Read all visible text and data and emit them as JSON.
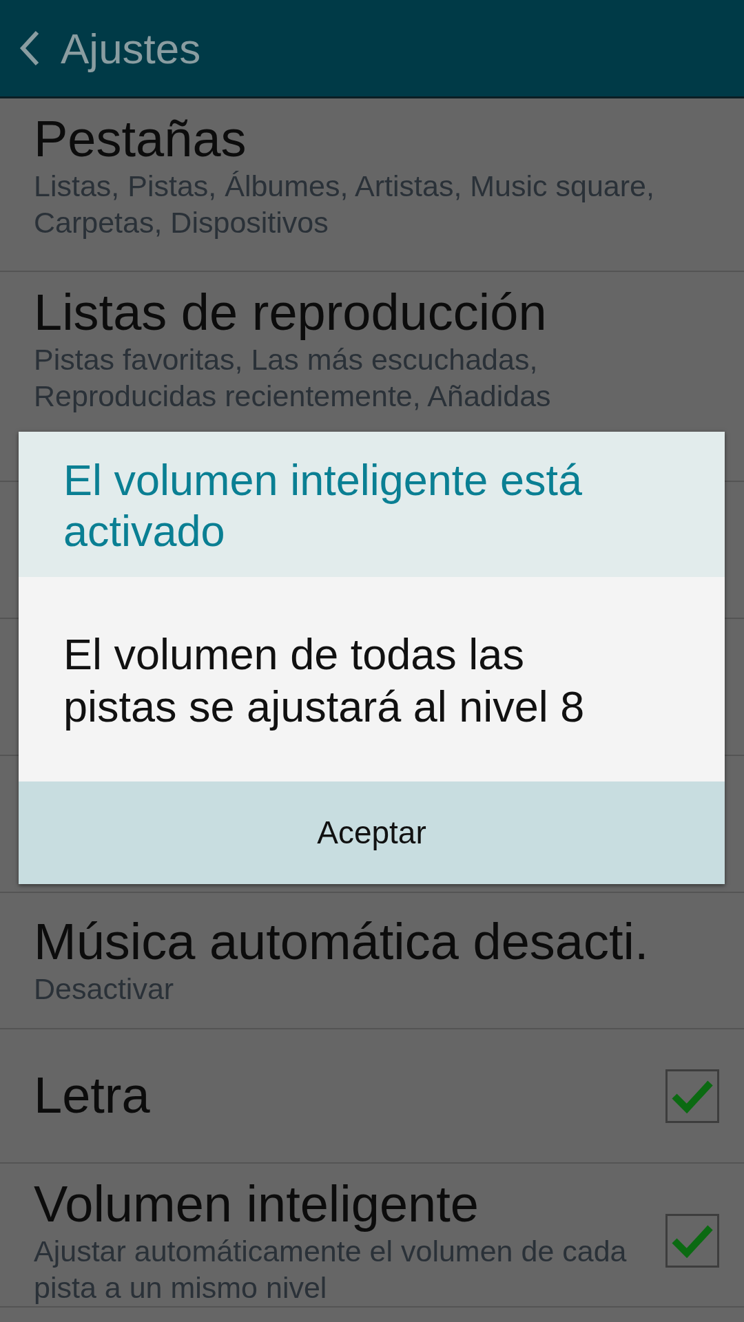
{
  "header": {
    "title": "Ajustes"
  },
  "items": [
    {
      "kind": "text",
      "title": "Pestañas",
      "subtitle": "Listas, Pistas, Álbumes, Artistas, Music square, Carpetas, Dispositivos"
    },
    {
      "kind": "text",
      "title": "Listas de reproducción",
      "subtitle": "Pistas favoritas, Las más escuchadas, Reproducidas recientemente, Añadidas"
    },
    {
      "kind": "hidden"
    },
    {
      "kind": "hidden"
    },
    {
      "kind": "hidden"
    },
    {
      "kind": "text",
      "title": "Música automática desacti.",
      "subtitle": "Desactivar"
    },
    {
      "kind": "check",
      "title": "Letra",
      "checked": true
    },
    {
      "kind": "check",
      "title": "Volumen inteligente",
      "subtitle": "Ajustar automáticamente el volumen de cada pista a un mismo nivel",
      "checked": true
    }
  ],
  "dialog": {
    "title": "El volumen inteligente está activado",
    "message": "El volumen de todas las pistas se ajustará al nivel 8",
    "button": "Aceptar"
  }
}
